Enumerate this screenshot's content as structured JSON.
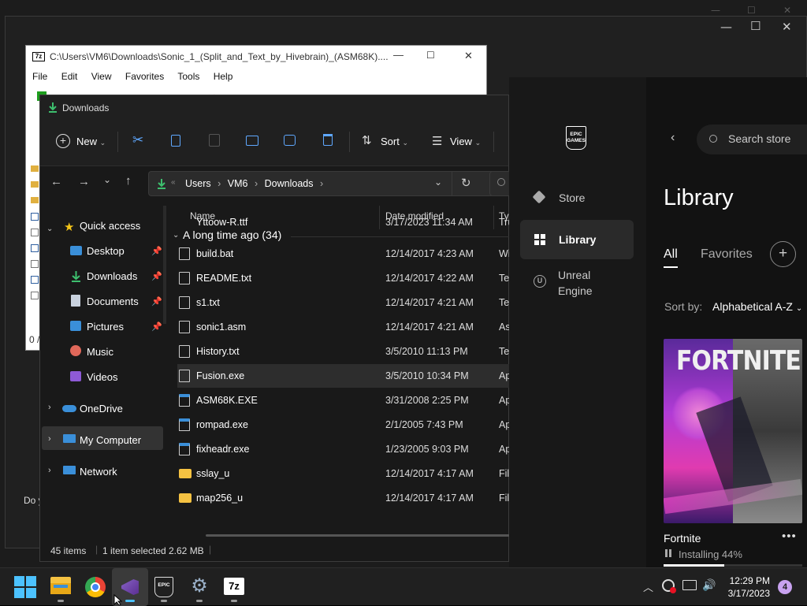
{
  "background_window": {
    "caption_min": "—",
    "caption_max": "☐",
    "caption_close": "✕",
    "partial_text": "Do y"
  },
  "sevenzip": {
    "title": "C:\\Users\\VM6\\Downloads\\Sonic_1_(Split_and_Text_by_Hivebrain)_(ASM68K)....",
    "logo": "7z",
    "menu": [
      "File",
      "Edit",
      "View",
      "Favorites",
      "Tools",
      "Help"
    ],
    "status_partial": "0 /"
  },
  "explorer": {
    "title": "Downloads",
    "toolbar": {
      "new_label": "New",
      "sort_label": "Sort",
      "view_label": "View"
    },
    "breadcrumb": [
      "Users",
      "VM6",
      "Downloads"
    ],
    "columns": {
      "name": "Name",
      "date": "Date modified",
      "type": "Typ"
    },
    "nav": {
      "quick_access": "Quick access",
      "items": [
        "Desktop",
        "Downloads",
        "Documents",
        "Pictures",
        "Music",
        "Videos"
      ],
      "onedrive": "OneDrive",
      "my_computer": "My Computer",
      "network": "Network"
    },
    "partial_row": {
      "name": "Yttoow-R.ttf",
      "date": "3/17/2023 11:34 AM",
      "type": "Tru"
    },
    "group_header": "A long time ago (34)",
    "files": [
      {
        "name": "build.bat",
        "date": "12/14/2017 4:23 AM",
        "type": "Wi",
        "icon": "bat-icon"
      },
      {
        "name": "README.txt",
        "date": "12/14/2017 4:22 AM",
        "type": "Tex",
        "icon": "text-file-icon"
      },
      {
        "name": "s1.txt",
        "date": "12/14/2017 4:21 AM",
        "type": "Tex",
        "icon": "text-file-icon"
      },
      {
        "name": "sonic1.asm",
        "date": "12/14/2017 4:21 AM",
        "type": "As",
        "icon": "file-icon"
      },
      {
        "name": "History.txt",
        "date": "3/5/2010 11:13 PM",
        "type": "Tex",
        "icon": "text-file-icon"
      },
      {
        "name": "Fusion.exe",
        "date": "3/5/2010 10:34 PM",
        "type": "Ap",
        "icon": "fusion-exe-icon"
      },
      {
        "name": "ASM68K.EXE",
        "date": "3/31/2008 2:25 PM",
        "type": "Ap",
        "icon": "exe-icon"
      },
      {
        "name": "rompad.exe",
        "date": "2/1/2005 7:43 PM",
        "type": "Ap",
        "icon": "exe-icon"
      },
      {
        "name": "fixheadr.exe",
        "date": "1/23/2005 9:03 PM",
        "type": "Ap",
        "icon": "exe-icon"
      },
      {
        "name": "sslay_u",
        "date": "12/14/2017 4:17 AM",
        "type": "Fil",
        "icon": "folder-icon"
      },
      {
        "name": "map256_u",
        "date": "12/14/2017 4:17 AM",
        "type": "Fil",
        "icon": "folder-icon"
      }
    ],
    "status": {
      "items": "45 items",
      "selected": "1 item selected",
      "size": "2.62 MB"
    }
  },
  "epic": {
    "logo_text": "EPIC\nGAMES",
    "search_placeholder": "Search store",
    "nav": {
      "store": "Store",
      "library": "Library",
      "unreal_line1": "Unreal",
      "unreal_line2": "Engine"
    },
    "heading": "Library",
    "tabs": {
      "all": "All",
      "favorites": "Favorites"
    },
    "sort_label": "Sort by:",
    "sort_value": "Alphabetical A-Z",
    "game": {
      "title": "Fortnite",
      "status": "Installing 44%",
      "progress": 0.44,
      "art_text": "FORTNITE"
    }
  },
  "taskbar": {
    "time": "12:29 PM",
    "date": "3/17/2023",
    "notification_count": "4",
    "apps": [
      "start",
      "file-explorer",
      "chrome",
      "visual-studio",
      "epic-games",
      "settings",
      "7zip"
    ],
    "epic_label": "EPIC",
    "sevenzip_label": "7z"
  },
  "colors": {
    "accent": "#0078d4",
    "epic_bg": "#121212",
    "explorer_bg": "#191919"
  }
}
